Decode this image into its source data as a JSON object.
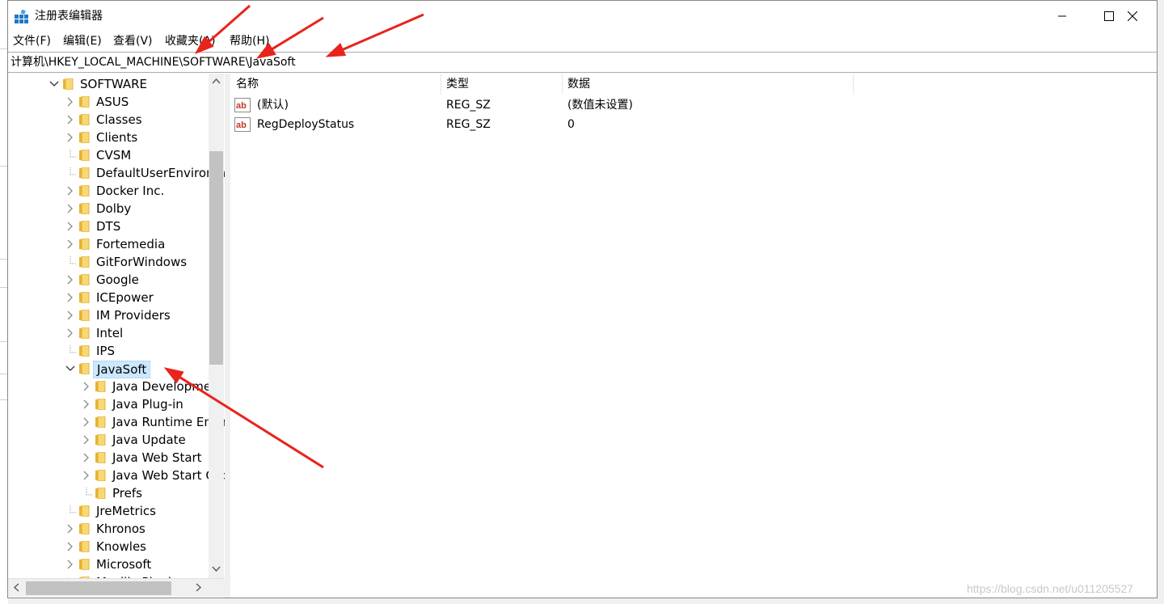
{
  "window": {
    "title": "注册表编辑器",
    "controls": [
      "minimize",
      "maximize",
      "close"
    ]
  },
  "menu": [
    "文件(F)",
    "编辑(E)",
    "查看(V)",
    "收藏夹(A)",
    "帮助(H)"
  ],
  "address": "计算机\\HKEY_LOCAL_MACHINE\\SOFTWARE\\JavaSoft",
  "tree": {
    "items": [
      {
        "label": "SOFTWARE",
        "expander": "expanded",
        "level": 0
      },
      {
        "label": "ASUS",
        "expander": "collapsed",
        "level": 1
      },
      {
        "label": "Classes",
        "expander": "collapsed",
        "level": 1
      },
      {
        "label": "Clients",
        "expander": "collapsed",
        "level": 1
      },
      {
        "label": "CVSM",
        "expander": "none",
        "level": 1
      },
      {
        "label": "DefaultUserEnvironment",
        "expander": "none",
        "level": 1
      },
      {
        "label": "Docker Inc.",
        "expander": "collapsed",
        "level": 1
      },
      {
        "label": "Dolby",
        "expander": "collapsed",
        "level": 1
      },
      {
        "label": "DTS",
        "expander": "collapsed",
        "level": 1
      },
      {
        "label": "Fortemedia",
        "expander": "collapsed",
        "level": 1
      },
      {
        "label": "GitForWindows",
        "expander": "none",
        "level": 1
      },
      {
        "label": "Google",
        "expander": "collapsed",
        "level": 1
      },
      {
        "label": "ICEpower",
        "expander": "collapsed",
        "level": 1
      },
      {
        "label": "IM Providers",
        "expander": "collapsed",
        "level": 1
      },
      {
        "label": "Intel",
        "expander": "collapsed",
        "level": 1
      },
      {
        "label": "IPS",
        "expander": "none",
        "level": 1
      },
      {
        "label": "JavaSoft",
        "expander": "expanded",
        "level": 1,
        "selected": true
      },
      {
        "label": "Java Development Kit",
        "expander": "collapsed",
        "level": 2
      },
      {
        "label": "Java Plug-in",
        "expander": "collapsed",
        "level": 2
      },
      {
        "label": "Java Runtime Environment",
        "expander": "collapsed",
        "level": 2
      },
      {
        "label": "Java Update",
        "expander": "collapsed",
        "level": 2
      },
      {
        "label": "Java Web Start",
        "expander": "collapsed",
        "level": 2
      },
      {
        "label": "Java Web Start Caps",
        "expander": "collapsed",
        "level": 2
      },
      {
        "label": "Prefs",
        "expander": "none",
        "level": 2
      },
      {
        "label": "JreMetrics",
        "expander": "none",
        "level": 1
      },
      {
        "label": "Khronos",
        "expander": "collapsed",
        "level": 1
      },
      {
        "label": "Knowles",
        "expander": "collapsed",
        "level": 1
      },
      {
        "label": "Microsoft",
        "expander": "collapsed",
        "level": 1
      },
      {
        "label": "Mozilla Plugins",
        "expander": "collapsed",
        "level": 1
      }
    ]
  },
  "values": {
    "columns": [
      "名称",
      "类型",
      "数据"
    ],
    "rows": [
      {
        "name": "(默认)",
        "type": "REG_SZ",
        "data": "(数值未设置)",
        "icon": "string-value-icon"
      },
      {
        "name": "RegDeployStatus",
        "type": "REG_SZ",
        "data": "0",
        "icon": "string-value-icon"
      }
    ]
  },
  "annotation_color": "#e8241c",
  "watermark": "https://blog.csdn.net/u011205527"
}
